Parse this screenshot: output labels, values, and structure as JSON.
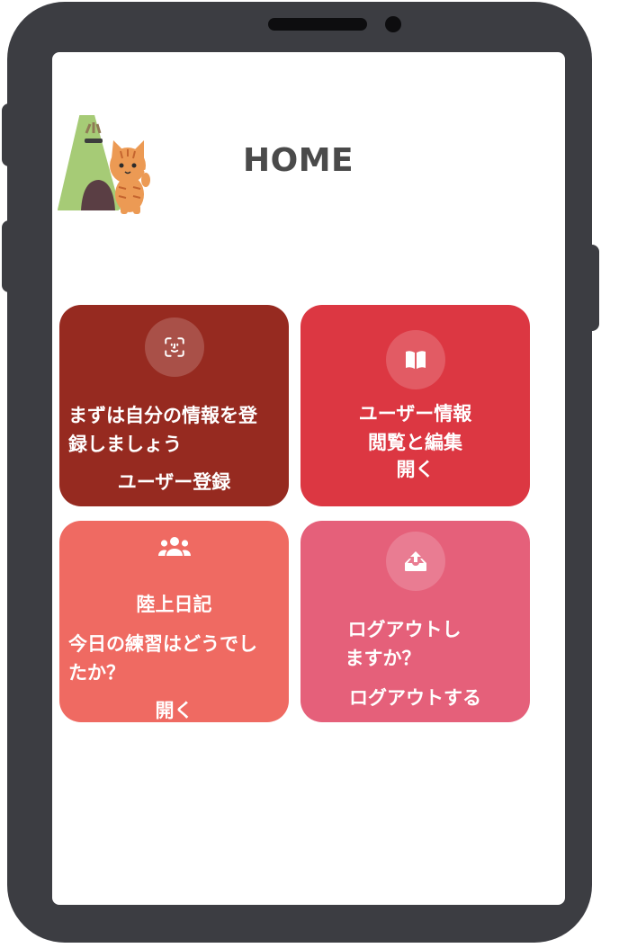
{
  "app": {
    "title": "HOME"
  },
  "colors": {
    "phone_frame": "#3c3d42",
    "card_register": "#962a20",
    "card_profile": "#dc3742",
    "card_diary": "#ef6a62",
    "card_logout": "#e5607a",
    "title_text": "#4a4a4a"
  },
  "cards": {
    "register": {
      "icon": "face-id-icon",
      "line1": "まずは自分の情報を登",
      "line2": "録しましょう",
      "action": "ユーザー登録"
    },
    "profile": {
      "icon": "book-open-icon",
      "line1": "ユーザー情報",
      "line2": "閲覧と編集",
      "action": "開く"
    },
    "diary": {
      "icon": "users-icon",
      "title": "陸上日記",
      "line1": "今日の練習はどうでし",
      "line2": "たか？",
      "action": "開く"
    },
    "logout": {
      "icon": "upload-tray-icon",
      "line1": "ログアウトし",
      "line2": "ますか？",
      "action": "ログアウトする"
    }
  }
}
